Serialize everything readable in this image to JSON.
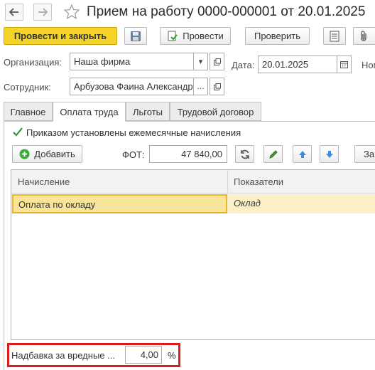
{
  "header": {
    "title": "Прием на работу 0000-000001 от 20.01.2025"
  },
  "toolbar": {
    "post_close_label": "Провести и закрыть",
    "post_label": "Провести",
    "check_label": "Проверить"
  },
  "form": {
    "organization_label": "Организация:",
    "organization_value": "Наша фирма",
    "date_label": "Дата:",
    "date_value": "20.01.2025",
    "number_label_partial": "Ном",
    "employee_label": "Сотрудник:",
    "employee_value": "Арбузова Фаина Александр"
  },
  "tabs": [
    {
      "label": "Главное",
      "active": false
    },
    {
      "label": "Оплата труда",
      "active": true
    },
    {
      "label": "Льготы",
      "active": false
    },
    {
      "label": "Трудовой договор",
      "active": false
    }
  ],
  "pay_tab": {
    "monthly_accruals_checkbox_label": "Приказом установлены ежемесячные начисления",
    "monthly_accruals_checked": true,
    "add_button_label": "Добавить",
    "fot_label": "ФОТ:",
    "fot_value": "47 840,00",
    "cut_button_label": "За",
    "grid": {
      "columns": [
        "Начисление",
        "Показатели"
      ],
      "rows": [
        {
          "accrual": "Оплата по окладу",
          "indicator": "Оклад",
          "selected": true
        }
      ]
    },
    "hazard_label": "Надбавка за вредные ...",
    "hazard_value": "4,00",
    "hazard_unit": "%"
  },
  "colors": {
    "primary_button": "#f5d327",
    "selected_row": "#fbf0c8",
    "highlight_border": "#e01b1b",
    "arrow_blue": "#3a8fd8",
    "add_green": "#3ea83a"
  }
}
